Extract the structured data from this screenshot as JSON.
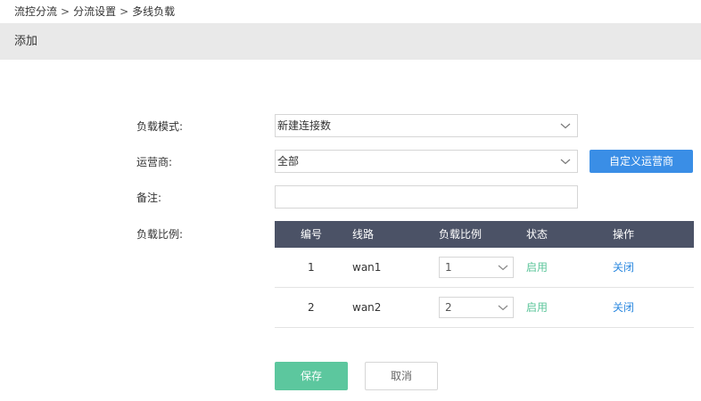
{
  "breadcrumb": {
    "items": [
      "流控分流",
      "分流设置",
      "多线负载"
    ],
    "separator": ">"
  },
  "section": {
    "title": "添加"
  },
  "form": {
    "load_mode": {
      "label": "负载模式:",
      "value": "新建连接数"
    },
    "isp": {
      "label": "运营商:",
      "value": "全部",
      "custom_button": "自定义运营商"
    },
    "remark": {
      "label": "备注:",
      "value": ""
    },
    "ratio": {
      "label": "负载比例:"
    }
  },
  "table": {
    "headers": [
      "编号",
      "线路",
      "负载比例",
      "状态",
      "操作"
    ],
    "rows": [
      {
        "id": "1",
        "line": "wan1",
        "ratio": "1",
        "status": "启用",
        "action": "关闭"
      },
      {
        "id": "2",
        "line": "wan2",
        "ratio": "2",
        "status": "启用",
        "action": "关闭"
      }
    ]
  },
  "buttons": {
    "save": "保存",
    "cancel": "取消"
  },
  "colors": {
    "header_bg": "#e9e9e9",
    "table_header_bg": "#4b5266",
    "primary_blue": "#3a8ee6",
    "save_green": "#5cc79e",
    "status_green": "#5bc59a",
    "link_blue": "#2d8ae0"
  },
  "icons": {
    "select_arrow": "chevron-down-icon"
  }
}
